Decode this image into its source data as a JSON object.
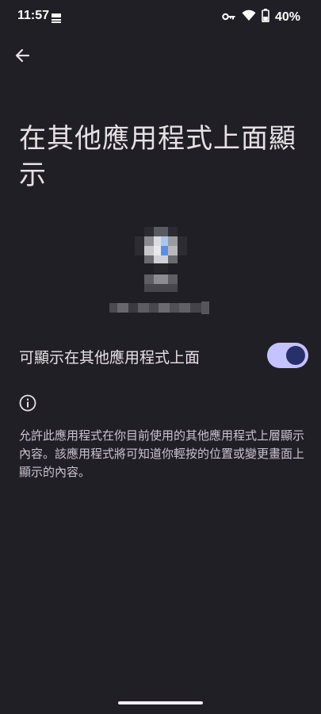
{
  "status_bar": {
    "time": "11:57",
    "notification_icon": "data-usage-280-icon",
    "icons": [
      "vpn-key-icon",
      "wifi-icon",
      "battery-icon"
    ],
    "battery_percent": "40%"
  },
  "header": {
    "back_icon": "arrow-back-icon"
  },
  "page": {
    "title": "在其他應用程式上面顯示"
  },
  "app": {
    "icon": "app-icon-pixelated"
  },
  "setting": {
    "label": "可顯示在其他應用程式上面",
    "toggle_state": true
  },
  "info": {
    "icon": "info-icon",
    "description": "允許此應用程式在你目前使用的其他應用程式上層顯示內容。該應用程式將可知道你輕按的位置或變更畫面上顯示的內容。"
  },
  "colors": {
    "background": "#211f26",
    "toggle_track": "#c5c3ff",
    "toggle_thumb": "#27306b",
    "text_primary": "#e6e1e5",
    "text_secondary": "#cac4d0"
  }
}
